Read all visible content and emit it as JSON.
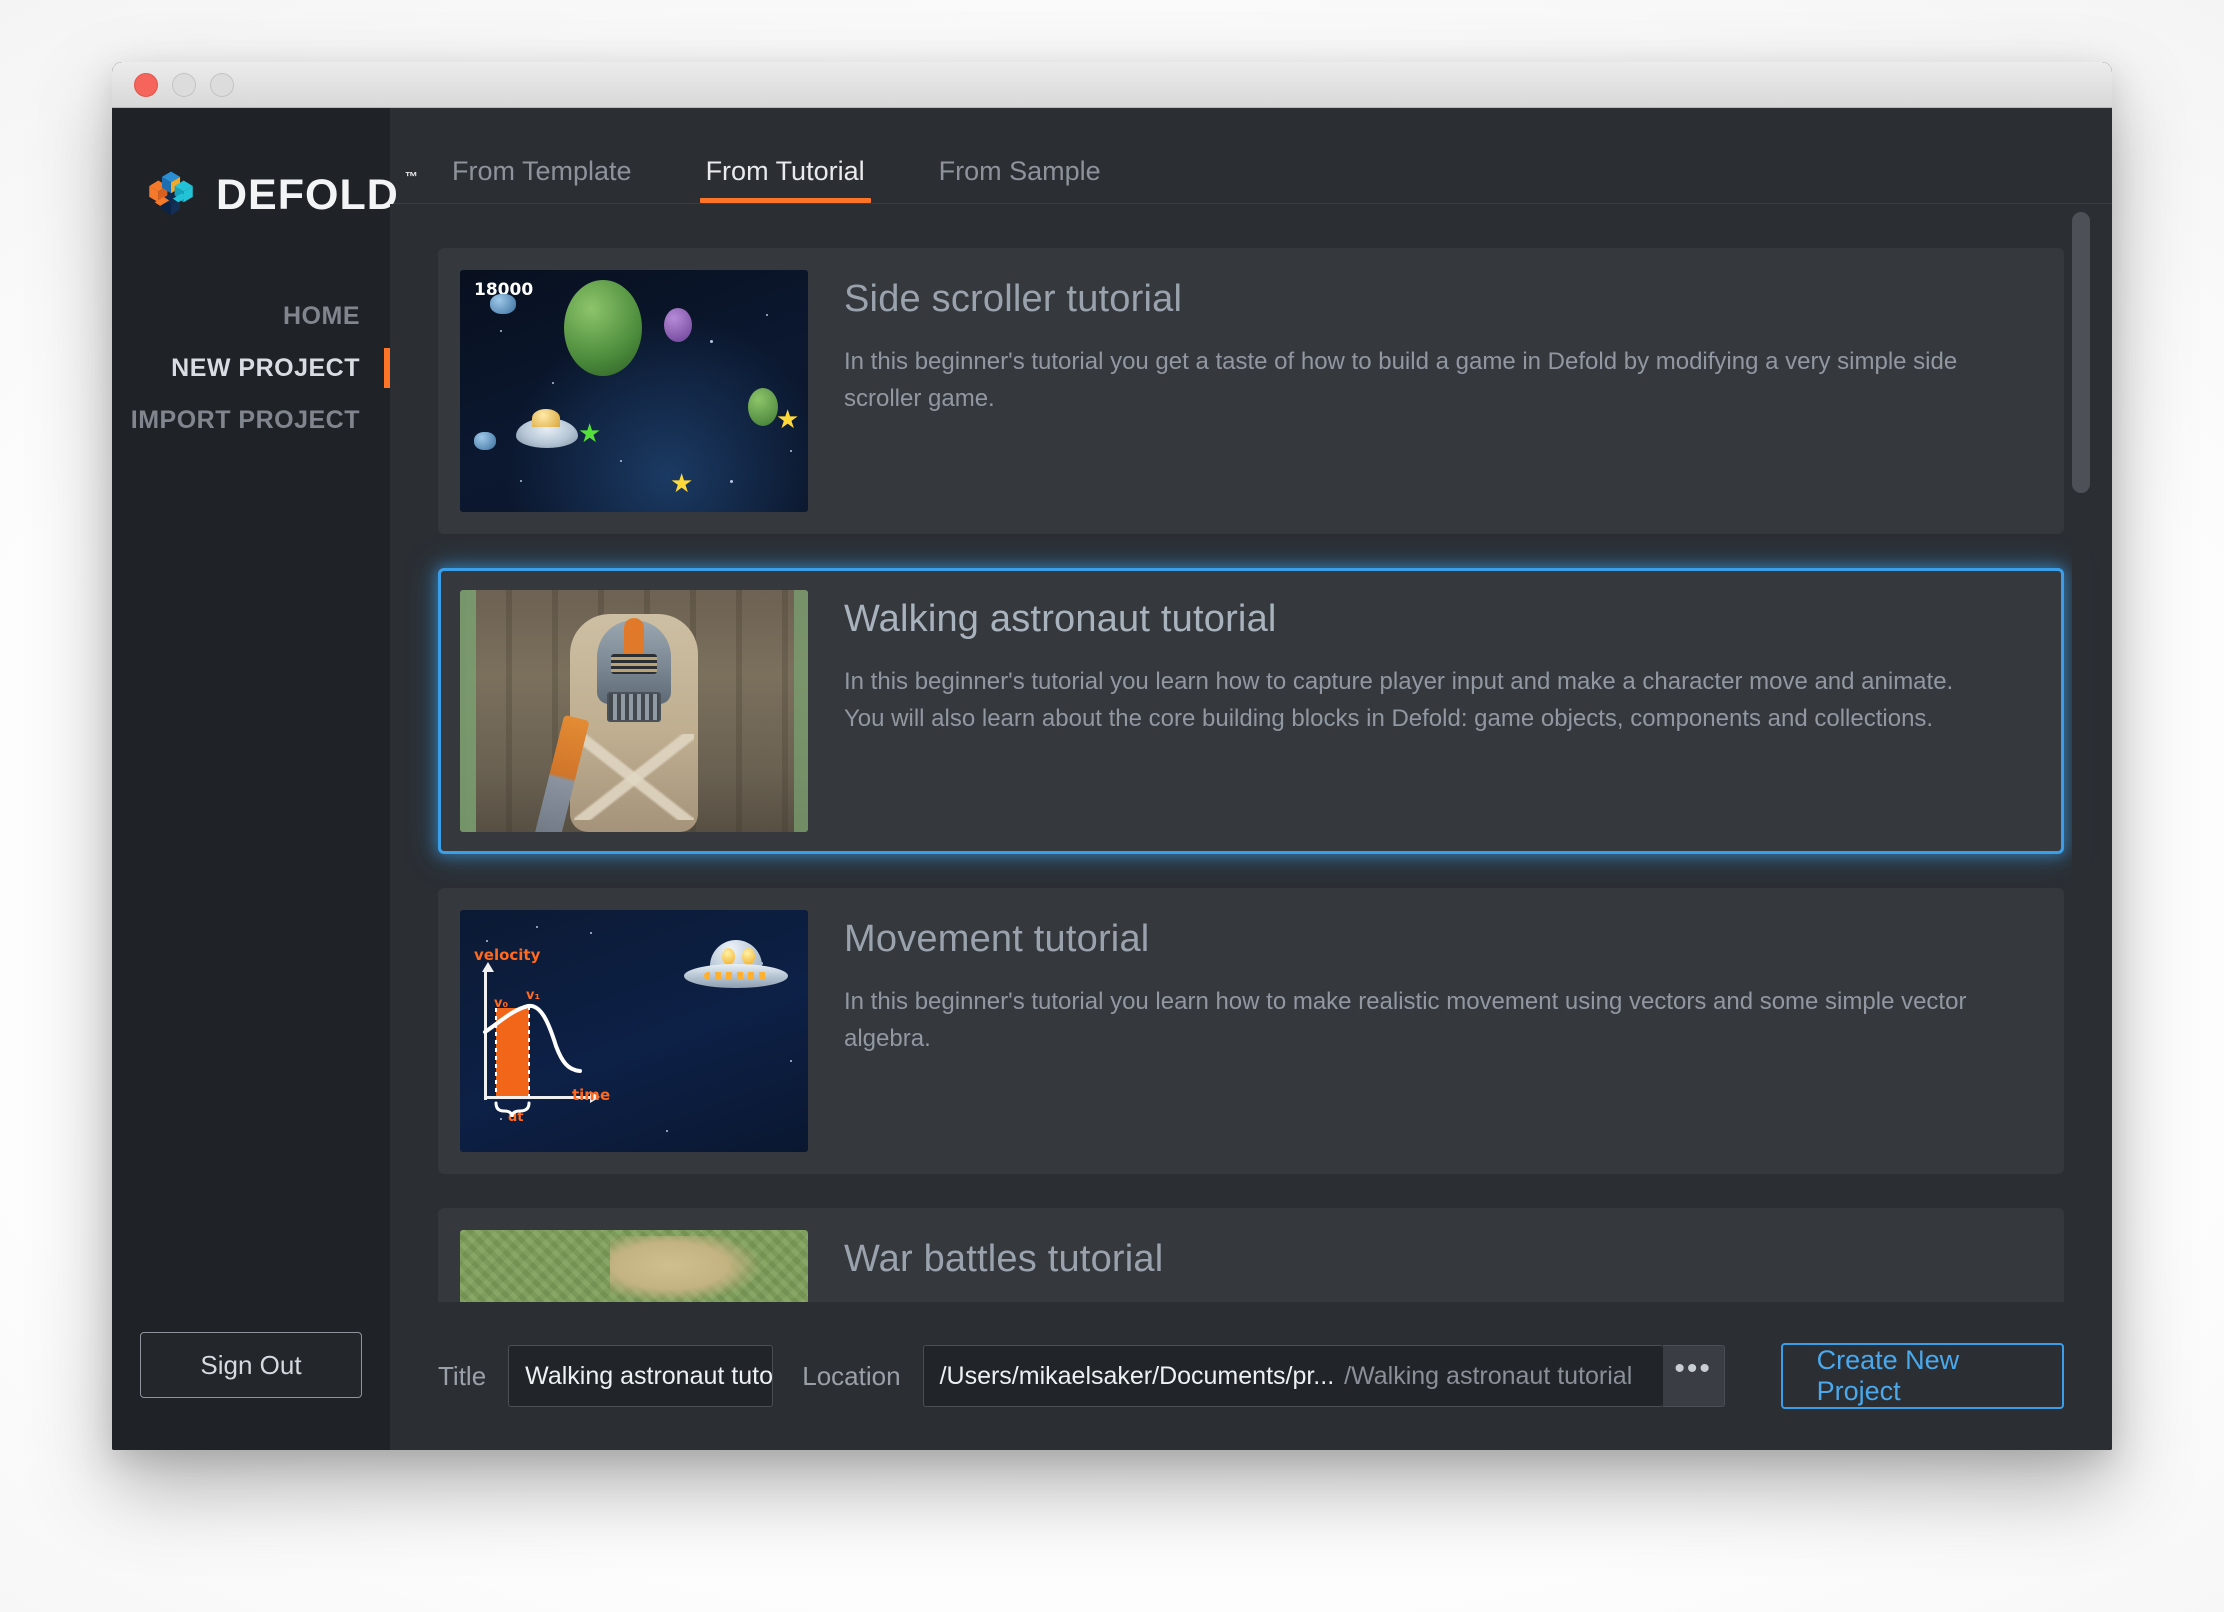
{
  "window": {
    "traffic_lights": [
      "close",
      "minimize",
      "maximize"
    ]
  },
  "sidebar": {
    "logo_text": "DEFOLD",
    "logo_tm": "™",
    "items": [
      {
        "label": "HOME",
        "active": false
      },
      {
        "label": "NEW PROJECT",
        "active": true
      },
      {
        "label": "IMPORT PROJECT",
        "active": false
      }
    ],
    "sign_out_label": "Sign Out"
  },
  "tabs": [
    {
      "label": "From Template",
      "active": false
    },
    {
      "label": "From Tutorial",
      "active": true
    },
    {
      "label": "From Sample",
      "active": false
    }
  ],
  "tutorials": [
    {
      "title": "Side scroller tutorial",
      "description": "In this beginner's tutorial you get a taste of how to build a game in Defold by modifying a very simple side scroller game.",
      "selected": false,
      "thumb_score": "18000"
    },
    {
      "title": "Walking astronaut tutorial",
      "description": "In this beginner's tutorial you learn how to capture player input and make a character move and animate. You will also learn about the core building blocks in Defold: game objects, components and collections.",
      "selected": true
    },
    {
      "title": "Movement tutorial",
      "description": "In this beginner's tutorial you learn how to make realistic movement using vectors and some simple vector algebra.",
      "selected": false,
      "thumb_labels": {
        "y_axis": "velocity",
        "x_axis": "time",
        "v0": "v₀",
        "v1": "v₁",
        "dt": "dt"
      }
    },
    {
      "title": "War battles tutorial",
      "description": "",
      "selected": false
    }
  ],
  "footer": {
    "title_label": "Title",
    "title_value": "Walking astronaut tutor",
    "location_label": "Location",
    "location_value": "/Users/mikaelsaker/Documents/pr...",
    "location_suffix": "/Walking astronaut tutorial",
    "browse_label": "•••",
    "create_label": "Create New Project"
  },
  "colors": {
    "accent_orange": "#ff7427",
    "accent_blue": "#3b9ee8",
    "panel_bg": "#2b2e33",
    "sidebar_bg": "#1f2226",
    "card_bg": "#35383d"
  },
  "scrollbar": {
    "thumb_top_pct": 0,
    "thumb_height_pct": 26
  }
}
